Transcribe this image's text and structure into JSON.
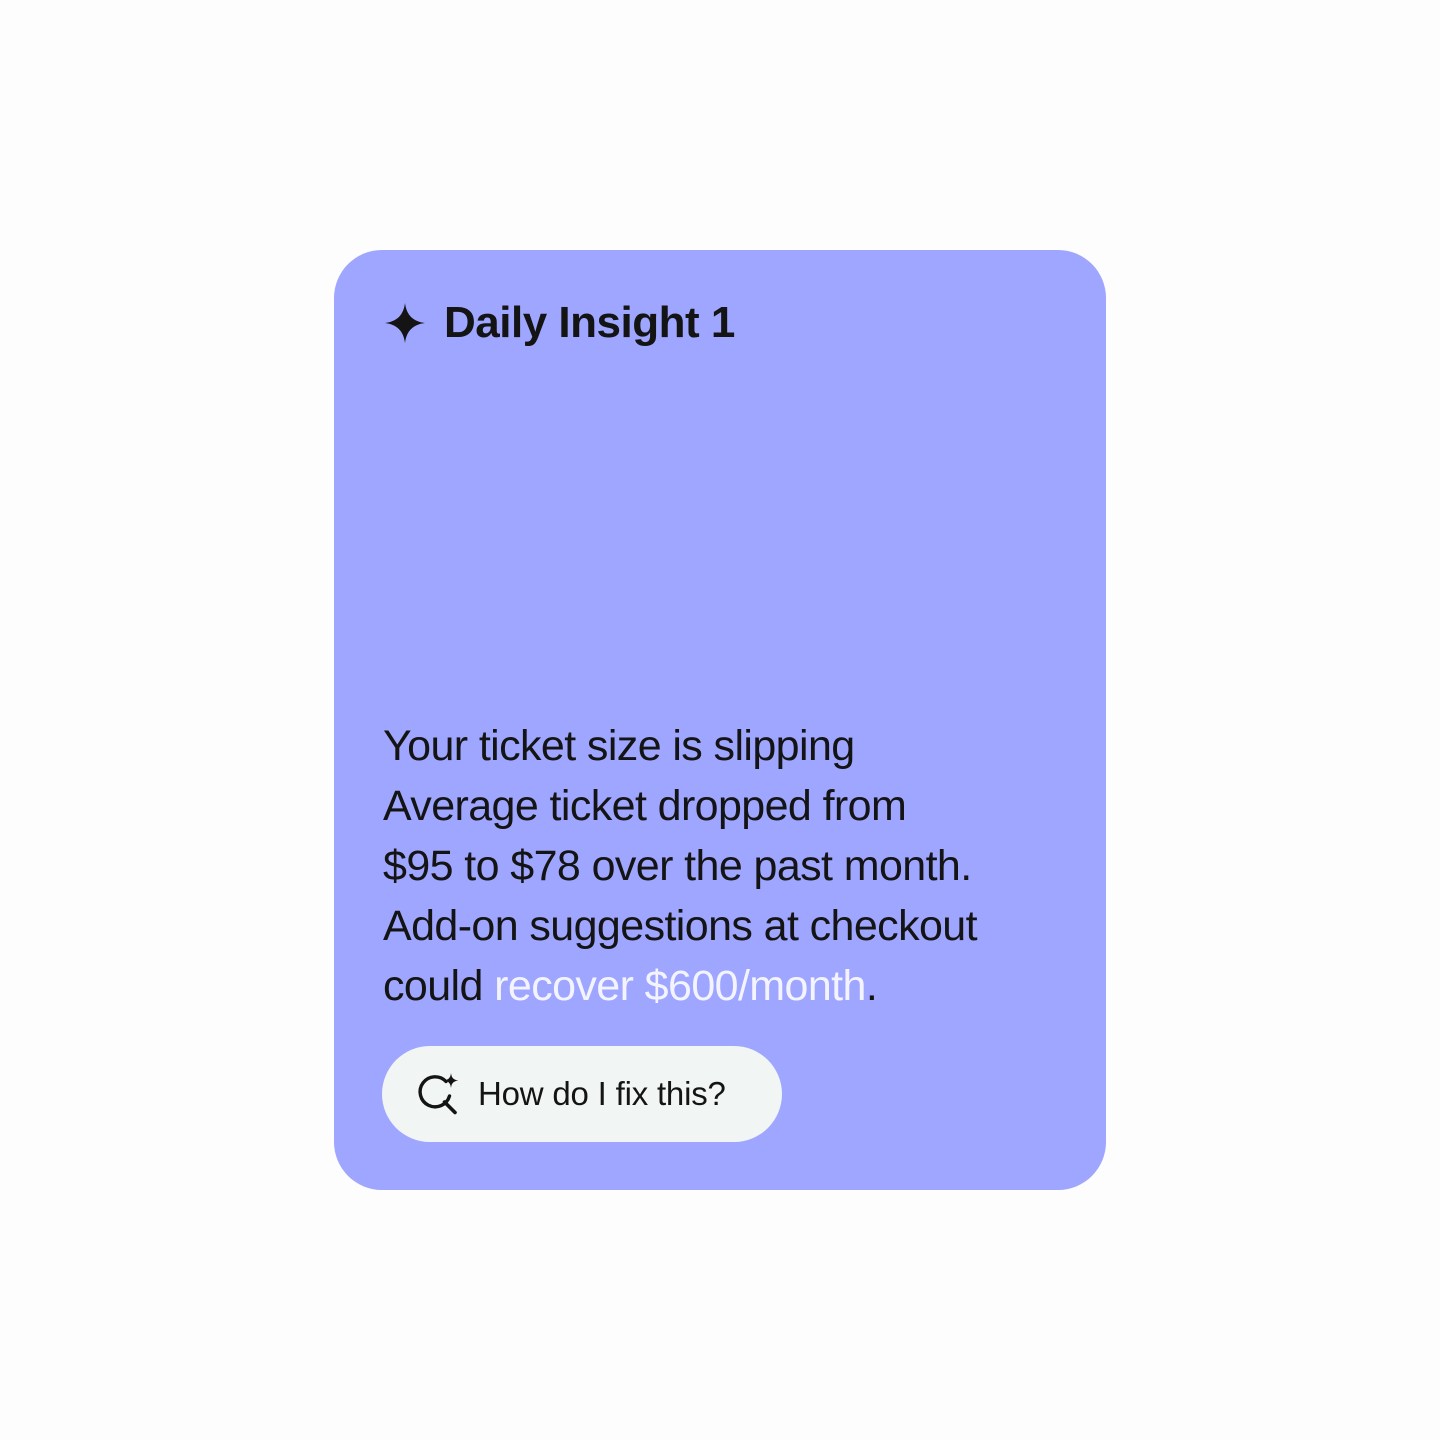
{
  "card": {
    "title": "Daily Insight 1",
    "title_icon": "sparkle-icon",
    "background_color": "#9fa6ff",
    "headline": "Your ticket size is slipping",
    "body_line_1": "Average ticket dropped from",
    "body_line_2": "$95 to $78 over the past month.",
    "body_line_3": "Add-on suggestions at checkout",
    "body_line_4_prefix": "could ",
    "body_line_4_highlight": "recover $600/month",
    "body_line_4_suffix": ".",
    "highlight_color": "#f3f4ff"
  },
  "cta": {
    "label": "How do I fix this?",
    "icon": "ai-search-icon",
    "background_color": "#f1f5f4"
  }
}
